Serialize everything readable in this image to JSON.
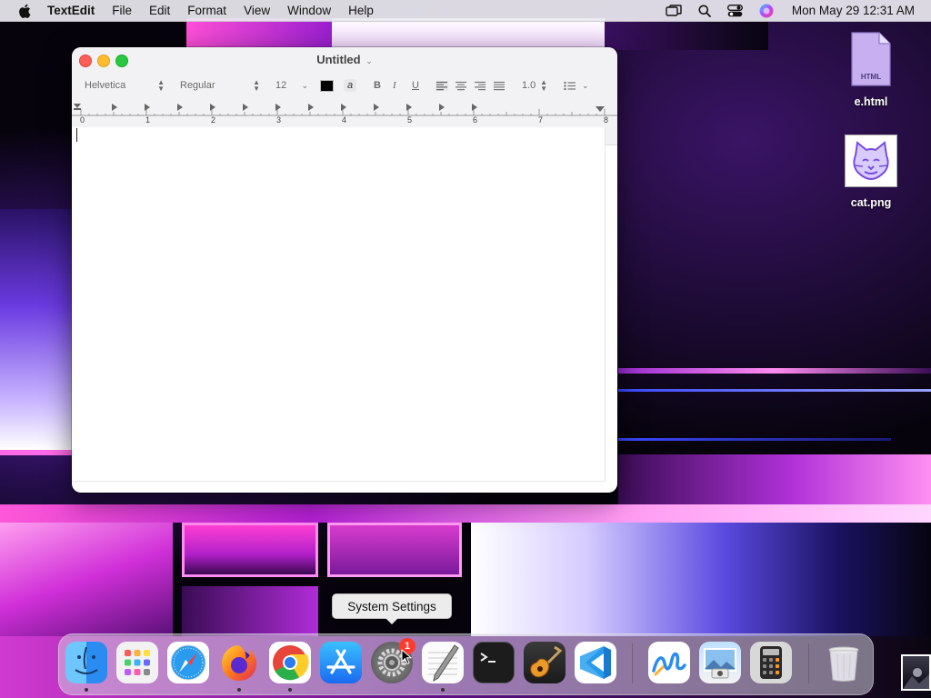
{
  "menubar": {
    "app_name": "TextEdit",
    "items": [
      "File",
      "Edit",
      "Format",
      "View",
      "Window",
      "Help"
    ],
    "clock": "Mon May 29  12:31 AM"
  },
  "desktop": {
    "icons": [
      {
        "label": "e.html",
        "badge": "HTML"
      },
      {
        "label": "cat.png"
      }
    ]
  },
  "window": {
    "title": "Untitled",
    "toolbar": {
      "font_family": "Helvetica",
      "font_style": "Regular",
      "font_size": "12",
      "bold": "B",
      "italic": "I",
      "underline": "U",
      "line_spacing": "1.0"
    },
    "ruler_numbers": [
      "0",
      "1",
      "2",
      "3",
      "4",
      "5",
      "6",
      "7",
      "8"
    ]
  },
  "tooltip": {
    "text": "System Settings"
  },
  "dock": {
    "apps": [
      "Finder",
      "Launchpad",
      "Safari",
      "Firefox",
      "Chrome",
      "App Store",
      "System Settings",
      "TextEdit",
      "Terminal",
      "GarageBand",
      "VS Code",
      "Freeform",
      "Preview",
      "Calculator",
      "Trash"
    ],
    "system_settings_badge": "1"
  },
  "colors": {
    "close": "#fe5f57",
    "minimize": "#febc2e",
    "zoom": "#28c840",
    "badge": "#ff3b30"
  }
}
